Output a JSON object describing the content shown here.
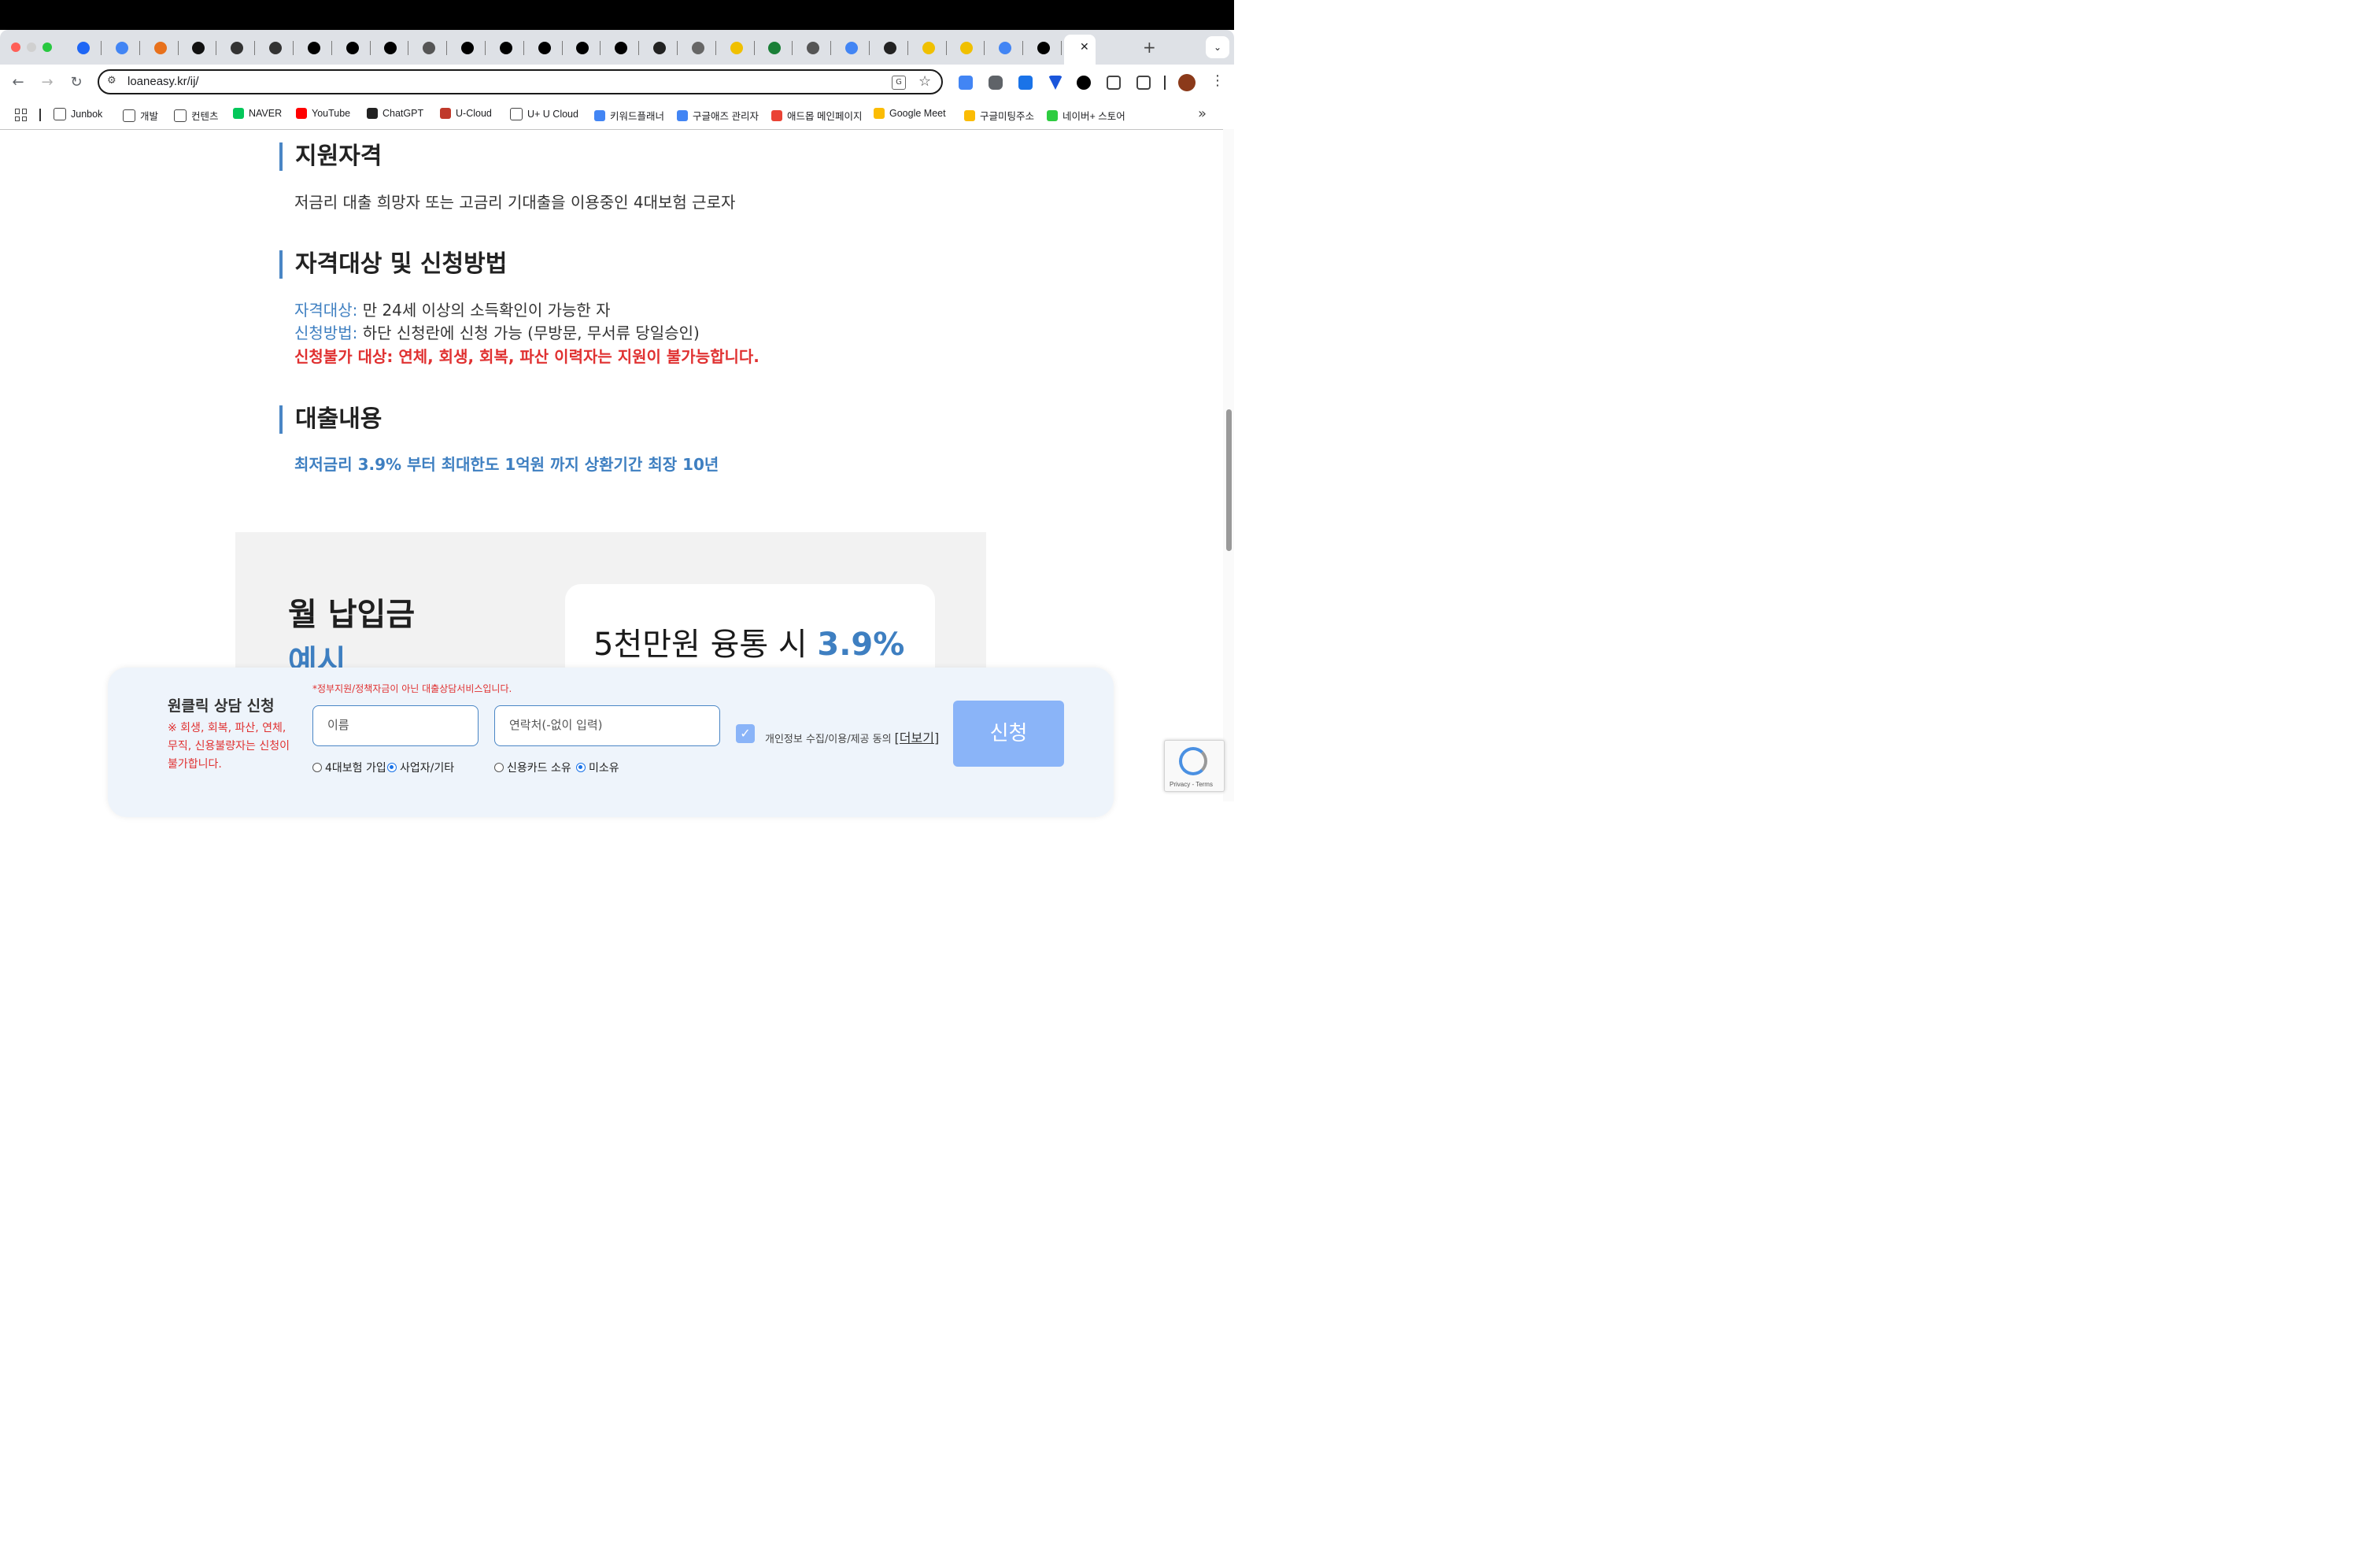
{
  "browser": {
    "url": "loaneasy.kr/ij/",
    "bookmarks": [
      "Junbok",
      "개발",
      "컨텐츠",
      "NAVER",
      "YouTube",
      "ChatGPT",
      "U-Cloud",
      "U+ U Cloud",
      "키워드플래너",
      "구글애즈 관리자",
      "애드몹 메인페이지",
      "Google Meet",
      "구글미팅주소",
      "네이버+ 스토어"
    ],
    "overflow": "»"
  },
  "sections": {
    "eligibility": {
      "title": "지원자격",
      "text": "저금리 대출 희망자 또는 고금리 기대출을 이용중인 4대보험 근로자"
    },
    "method": {
      "title": "자격대상 및 신청방법",
      "target_label": "자격대상:",
      "target_text": " 만 24세 이상의 소득확인이 가능한 자",
      "method_label": "신청방법:",
      "method_text": " 하단 신청란에 신청 가능 (무방문, 무서류 당일승인)",
      "exclusion": "신청불가 대상: 연체, 회생, 회복, 파산 이력자는 지원이 불가능합니다."
    },
    "loan": {
      "title": "대출내용",
      "text": "최저금리 3.9% 부터 최대한도 1억원 까지 상환기간 최장 10년"
    }
  },
  "monthly": {
    "title_line1": "월 납입금",
    "title_line2": "예시",
    "card_text": "5천만원 융통 시 ",
    "card_rate": "3.9%"
  },
  "form": {
    "title": "원클릭 상담 신청",
    "warning": "※ 회생, 회복, 파산, 연체, 무직, 신용불량자는 신청이 불가합니다.",
    "notice": "*정부지원/정책자금이 아닌 대출상담서비스입니다.",
    "name_placeholder": "이름",
    "phone_placeholder": "연락처(-없이 입력)",
    "radio_insurance": "4대보험 가입",
    "radio_business": "사업자/기타",
    "radio_card": "신용카드 소유",
    "radio_nocard": "미소유",
    "agree_text": "개인정보 수집/이용/제공 동의",
    "more_label": "[더보기]",
    "submit": "신청",
    "selected_employment": "사업자/기타",
    "selected_card": "미소유",
    "agree_checked": true
  },
  "recaptcha": {
    "text": "Privacy - Terms"
  },
  "colors": {
    "accent": "#3e7fc1",
    "warning": "#e03131",
    "button": "#8ab4f8"
  }
}
